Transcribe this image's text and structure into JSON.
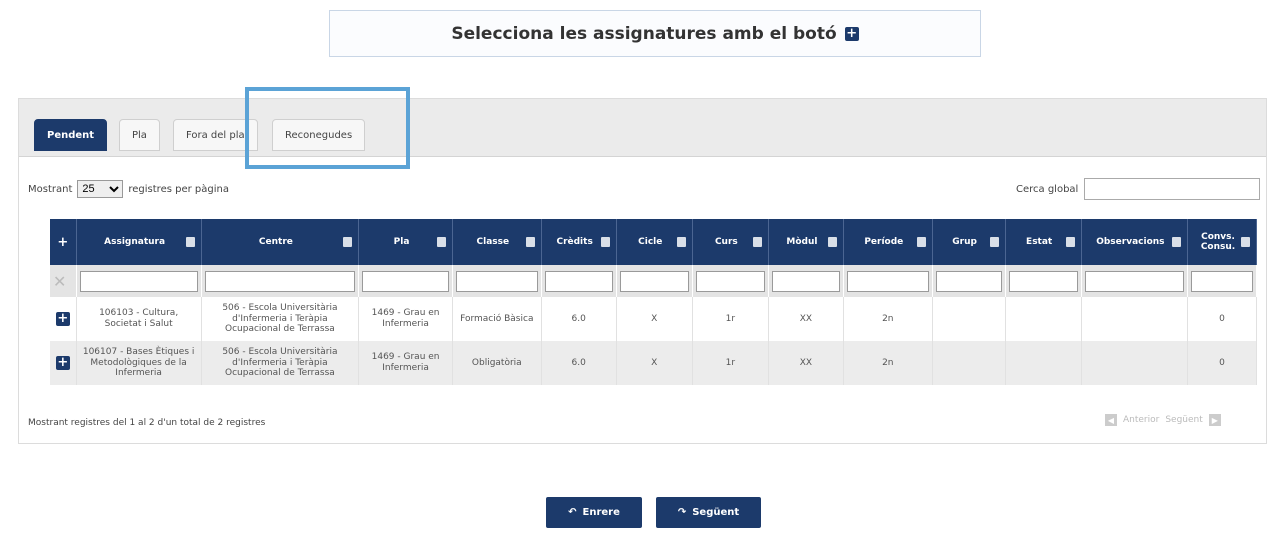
{
  "banner": {
    "text": "Selecciona les assignatures amb el botó",
    "icon": "plus-square-icon"
  },
  "tabs": [
    {
      "label": "Pendent",
      "active": true
    },
    {
      "label": "Pla",
      "active": false
    },
    {
      "label": "Fora del pla",
      "active": false
    },
    {
      "label": "Reconegudes",
      "active": false
    }
  ],
  "length_control": {
    "prefix": "Mostrant",
    "value": "25",
    "suffix": "registres per pàgina"
  },
  "search": {
    "label": "Cerca global",
    "value": ""
  },
  "table": {
    "headers": [
      "Assignatura",
      "Centre",
      "Pla",
      "Classe",
      "Crèdits",
      "Cicle",
      "Curs",
      "Mòdul",
      "Període",
      "Grup",
      "Estat",
      "Observacions",
      "Convs. Consu."
    ],
    "rows": [
      [
        "106103 - Cultura, Societat i Salut",
        "506 - Escola Universitària d'Infermeria i Teràpia Ocupacional de Terrassa",
        "1469 - Grau en Infermeria",
        "Formació Bàsica",
        "6.0",
        "X",
        "1r",
        "XX",
        "2n",
        "",
        "",
        "",
        "0"
      ],
      [
        "106107 - Bases Ètiques i Metodològiques de la Infermeria",
        "506 - Escola Universitària d'Infermeria i Teràpia Ocupacional de Terrassa",
        "1469 - Grau en Infermeria",
        "Obligatòria",
        "6.0",
        "X",
        "1r",
        "XX",
        "2n",
        "",
        "",
        "",
        "0"
      ]
    ]
  },
  "info": "Mostrant registres del 1 al 2 d'un total de 2 registres",
  "pager": {
    "prev": "Anterior",
    "next": "Següent"
  },
  "buttons": {
    "back": "Enrere",
    "next": "Següent"
  },
  "colors": {
    "primary": "#1c3a6b",
    "highlight": "#5ba3d6"
  }
}
